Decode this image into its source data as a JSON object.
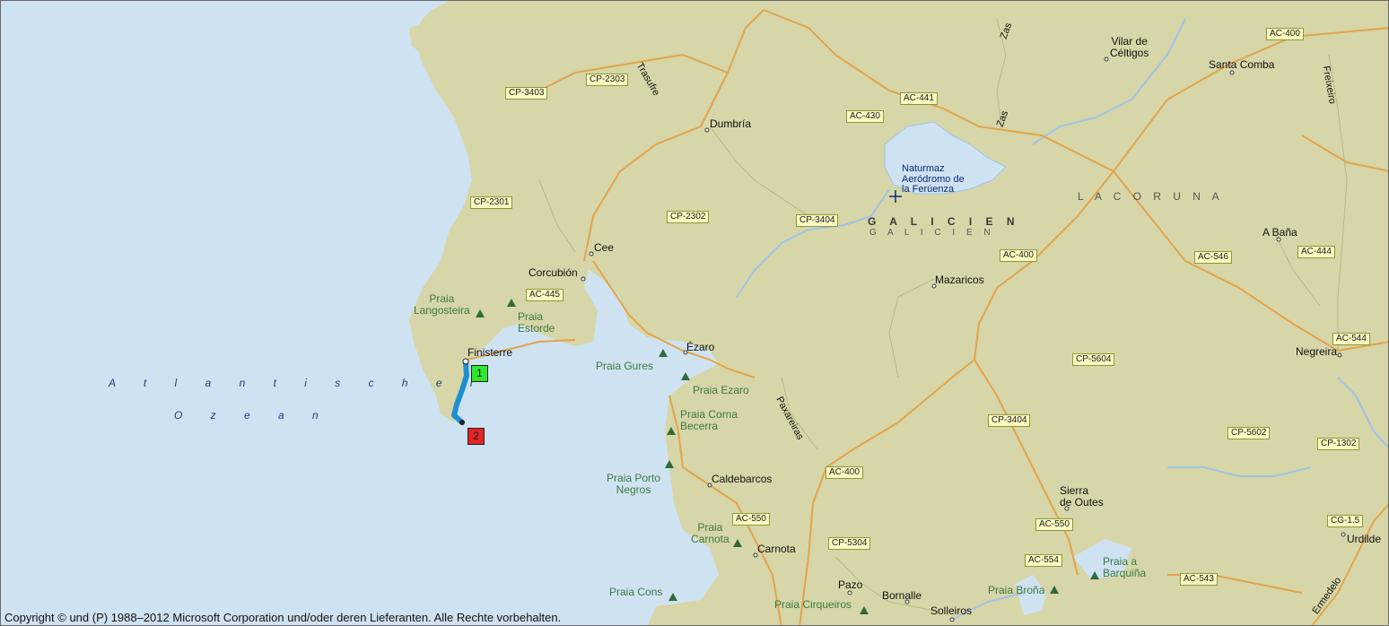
{
  "map": {
    "colors": {
      "water": "#cfe2f2",
      "land": "#d6d6a8",
      "road": "#e3a44a",
      "river": "#9fc4e6",
      "route": "#1b8fd1",
      "start_marker": "#2ee82e",
      "end_marker": "#e32626"
    },
    "water_labels": {
      "ocean_line1": "A t l a n t i s c h e r",
      "ocean_line2": "O z e a n"
    },
    "region_labels": {
      "province": "L A  C O R U N A",
      "region_bold": "G A L I C I E N",
      "region_shadow": "G A L I C I E N"
    },
    "towns": {
      "dumbria": "Dumbría",
      "cee": "Cee",
      "corcubion": "Corcubión",
      "finisterre": "Finisterre",
      "ezaro": "Ézaro",
      "mazaricos": "Mazaricos",
      "vilar_1": "Vilar de",
      "vilar_2": "Céltigos",
      "santa_comba": "Santa Comba",
      "a_bana": "A Baña",
      "negreira": "Negreira",
      "caldebarcos": "Caldebarcos",
      "carnota": "Carnota",
      "sierra_1": "Sierra",
      "sierra_2": "de Outes",
      "pazo": "Pazo",
      "bornalle": "Bornalle",
      "solleiros": "Solleiros",
      "urdilde": "Urdilde"
    },
    "poi": {
      "line1": "Naturmaz",
      "line2": "Aeródromo de",
      "line3": "la Ferúenza"
    },
    "beaches": {
      "langosteira_1": "Praia",
      "langosteira_2": "Langosteira",
      "estorde_1": "Praia",
      "estorde_2": "Estorde",
      "gures": "Praia Gures",
      "ezaro": "Praia Ezaro",
      "corna_1": "Praia Corna",
      "corna_2": "Becerra",
      "porto_1": "Praia Porto",
      "porto_2": "Negros",
      "carnota_1": "Praia",
      "carnota_2": "Carnota",
      "cons": "Praia Cons",
      "cirqueiros": "Praia Cirqueiros",
      "brona": "Praia Broña",
      "barquina_1": "Praia a",
      "barquina_2": "Barquiña"
    },
    "road_names": {
      "trasufre": "Trasufre",
      "zas1": "Zas",
      "zas2": "Zas",
      "freixeiro": "Freixeiro",
      "paxareiras": "Paxareiras",
      "ermedelo": "Ermedelo"
    },
    "road_shields": {
      "cp3403": "CP-3403",
      "cp2303": "CP-2303",
      "ac430": "AC-430",
      "ac441": "AC-441",
      "ac400a": "AC-400",
      "cp2301": "CP-2301",
      "cp2302": "CP-2302",
      "cp3404a": "CP-3404",
      "ac445": "AC-445",
      "ac400b": "AC-400",
      "ac546": "AC-546",
      "ac444": "AC-444",
      "ac544": "AC-544",
      "cp5604": "CP-5604",
      "cp3404b": "CP-3404",
      "cp5602": "CP-5602",
      "cp1302": "CP-1302",
      "ac400c": "AC-400",
      "ac550a": "AC-550",
      "ac550b": "AC-550",
      "cp5304": "CP-5304",
      "cg15": "CG-1.5",
      "ac554": "AC-554",
      "ac543": "AC-543"
    },
    "markers": {
      "start": "1",
      "end": "2"
    },
    "copyright": "Copyright © und (P) 1988–2012 Microsoft Corporation und/oder deren Lieferanten. Alle Rechte vorbehalten."
  }
}
